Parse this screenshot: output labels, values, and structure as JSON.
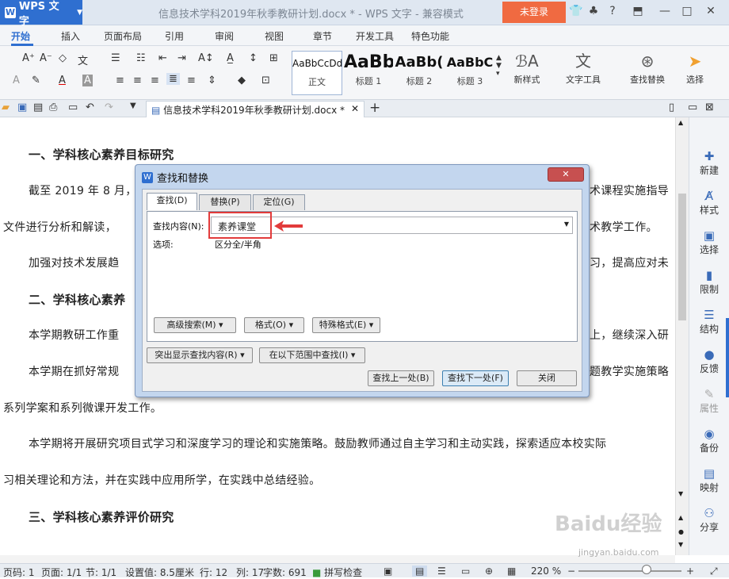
{
  "app": {
    "name": "WPS 文字",
    "title": "信息技术学科2019年秋季教研计划.docx * - WPS 文字 - 兼容模式",
    "login": "未登录"
  },
  "menu": [
    "开始",
    "插入",
    "页面布局",
    "引用",
    "审阅",
    "视图",
    "章节",
    "开发工具",
    "特色功能"
  ],
  "ribbon": {
    "styles": [
      {
        "sample": "AaBbCcDd",
        "label": "正文"
      },
      {
        "sample": "AaBb",
        "label": "标题 1"
      },
      {
        "sample": "AaBb(",
        "label": "标题 2"
      },
      {
        "sample": "AaBbC",
        "label": "标题 3"
      }
    ],
    "new_style": "新样式",
    "text_tools": "文字工具",
    "find_replace": "查找替换",
    "select": "选择"
  },
  "doc_tab": "信息技术学科2019年秋季教研计划.docx *",
  "document": [
    "一、学科核心素养目标研究",
    "截至 2019 年 8 月，",
    "术课程实施指导",
    "文件进行分析和解读，",
    "术教学工作。",
    "加强对技术发展趋",
    "习，提高应对未",
    "二、学科核心素养",
    "本学期教研工作重",
    "上，继续深入研",
    "本学期在抓好常规",
    "题教学实施策略",
    "系列学案和系列微课开发工作。",
    "本学期将开展研究项目式学习和深度学习的理论和实施策略。鼓励教师通过自主学习和主动实践，探索适应本校实际",
    "习相关理论和方法，并在实践中应用所学，在实践中总结经验。",
    "三、学科核心素养评价研究"
  ],
  "dialog": {
    "title": "查找和替换",
    "tabs": [
      "查找(D)",
      "替换(P)",
      "定位(G)"
    ],
    "find_label": "查找内容(N):",
    "find_value": "素养课堂",
    "options_label": "选项:",
    "options_value": "区分全/半角",
    "advanced": "高级搜索(M) ▾",
    "format": "格式(O) ▾",
    "special": "特殊格式(E) ▾",
    "highlight": "突出显示查找内容(R) ▾",
    "range": "在以下范围中查找(I) ▾",
    "find_prev": "查找上一处(B)",
    "find_next": "查找下一处(F)",
    "close": "关闭"
  },
  "right_panel": [
    "新建",
    "样式",
    "选择",
    "限制",
    "结构",
    "反馈",
    "属性",
    "备份",
    "映射",
    "分享"
  ],
  "status": {
    "page_num": "页码: 1",
    "pages": "页面: 1/1",
    "section": "节: 1/1",
    "setting": "设置值: 8.5厘米",
    "row": "行: 12",
    "col": "列: 17",
    "words": "字数: 691",
    "spell": "拼写检查",
    "zoom": "220 %"
  },
  "watermark": {
    "text": "Baidu经验",
    "url": "jingyan.baidu.com"
  },
  "colors": {
    "accent": "#2f6fd0",
    "login": "#f06a41",
    "highlight": "#e23b3b"
  }
}
